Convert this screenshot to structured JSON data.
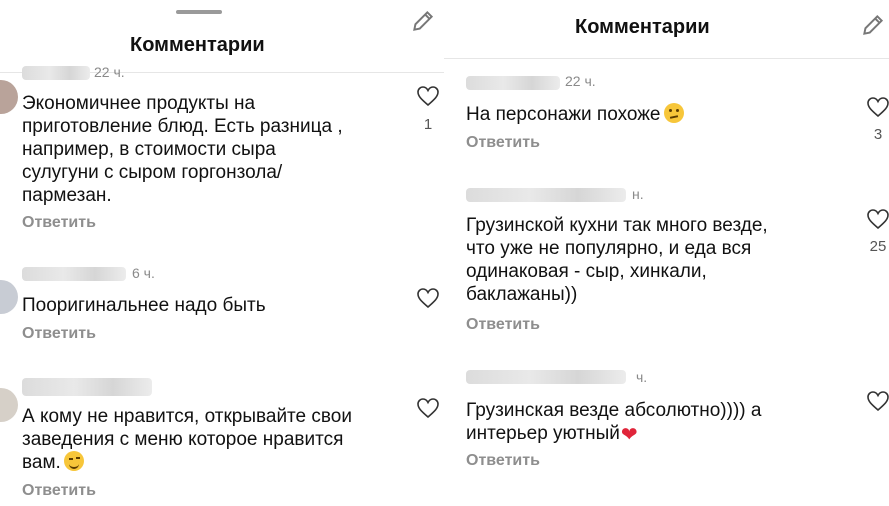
{
  "header": {
    "title": "Комментарии"
  },
  "left": {
    "comments": [
      {
        "time": "22 ч.",
        "lines": [
          "Экономичнее продукты на",
          "приготовление блюд. Есть разница ,",
          "например, в стоимости сыра",
          "сулугуни с сыром горгонзола/",
          "пармезан."
        ],
        "reply": "Ответить",
        "likes": "1"
      },
      {
        "time": "6 ч.",
        "lines": [
          "Пооригинальнее надо быть"
        ],
        "reply": "Ответить"
      },
      {
        "lines": [
          "А кому не нравится, открывайте свои",
          "заведения с меню которое нравится",
          "вам."
        ],
        "emoji": "winking-face",
        "reply": "Ответить"
      }
    ]
  },
  "right": {
    "comments": [
      {
        "time": "22 ч.",
        "text": "На персонажи похоже",
        "emoji": "thinking-face",
        "reply": "Ответить",
        "likes": "3"
      },
      {
        "time": "н.",
        "lines": [
          "Грузинской кухни так  много везде,",
          "что уже не популярно, и еда вся",
          "одинаковая - сыр, хинкали,",
          "баклажаны))"
        ],
        "reply": "Ответить",
        "likes": "25"
      },
      {
        "time": "ч.",
        "lines": [
          "Грузинская везде абсолютно)))) а",
          "интерьер уютный"
        ],
        "emoji": "red-heart",
        "reply": "Ответить"
      }
    ]
  }
}
